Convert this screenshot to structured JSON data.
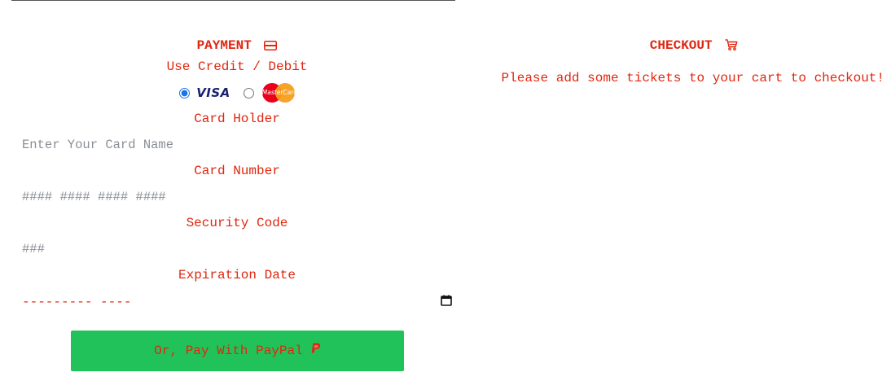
{
  "payment": {
    "title": "PAYMENT",
    "title_icon": "credit-card-icon",
    "method_label": "Use Credit / Debit",
    "card_options": [
      {
        "name": "VISA",
        "selected": true
      },
      {
        "name": "MasterCard",
        "selected": false
      }
    ],
    "card_holder": {
      "label": "Card Holder",
      "placeholder": "Enter Your Card Name"
    },
    "card_number": {
      "label": "Card Number",
      "placeholder": "#### #### #### ####"
    },
    "security_code": {
      "label": "Security Code",
      "placeholder": "###"
    },
    "expiration": {
      "label": "Expiration Date",
      "value": "--------- ----",
      "icon": "calendar-icon"
    },
    "paypal_button": {
      "label": "Or, Pay With PayPal",
      "icon": "paypal-icon",
      "color": "#22c25a"
    }
  },
  "checkout": {
    "title": "CHECKOUT",
    "title_icon": "cart-icon",
    "empty_message": "Please add some tickets to your cart to checkout!"
  },
  "colors": {
    "accent_text": "#e0260f",
    "paypal_green": "#22c25a",
    "placeholder": "#8a8f97"
  }
}
